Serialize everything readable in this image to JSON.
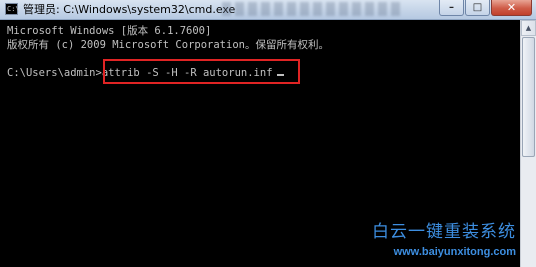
{
  "window": {
    "title": "管理员: C:\\Windows\\system32\\cmd.exe",
    "icon": "cmd-icon",
    "icon_glyph": "C:\\",
    "buttons": {
      "minimize": "–",
      "maximize": "□",
      "close": "✕"
    }
  },
  "console": {
    "lines": [
      "Microsoft Windows [版本 6.1.7600]",
      "版权所有 (c) 2009 Microsoft Corporation。保留所有权利。",
      ""
    ],
    "prompt": "C:\\Users\\admin>",
    "command": "attrib -S -H -R autorun.inf",
    "text_color": "#c0c0c0",
    "highlight_color": "#e02424"
  },
  "watermark": {
    "title": "白云一键重装系统",
    "url": "www.baiyunxitong.com",
    "color": "#3d8ee0"
  }
}
